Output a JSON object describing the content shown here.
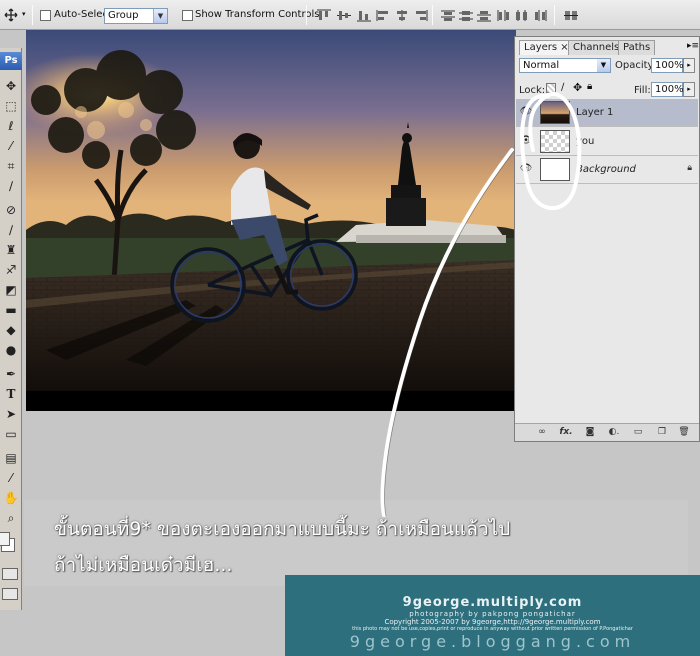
{
  "options_bar": {
    "move_tool_icon": "move-icon",
    "auto_select_label": "Auto-Select:",
    "auto_select_checked": false,
    "auto_select_value": "Group",
    "show_transform_label": "Show Transform Controls",
    "show_transform_checked": false
  },
  "toolbox": {
    "logo_text": "Ps",
    "tools": [
      "move-icon",
      "marquee-icon",
      "lasso-icon",
      "magic-wand-icon",
      "crop-icon",
      "slice-icon",
      "healing-brush-icon",
      "brush-icon",
      "clone-stamp-icon",
      "history-brush-icon",
      "eraser-icon",
      "gradient-icon",
      "blur-icon",
      "dodge-icon",
      "pen-icon",
      "type-icon",
      "path-selection-icon",
      "shape-icon",
      "notes-icon",
      "eyedropper-icon",
      "hand-icon",
      "zoom-icon"
    ],
    "type_tool_glyph": "T"
  },
  "layers_panel": {
    "tabs": [
      {
        "label": "Layers",
        "active": true
      },
      {
        "label": "Channels",
        "active": false
      },
      {
        "label": "Paths",
        "active": false
      }
    ],
    "blend_mode": "Normal",
    "opacity_label": "Opacity:",
    "opacity_value": "100%",
    "lock_label": "Lock:",
    "fill_label": "Fill:",
    "fill_value": "100%",
    "layers": [
      {
        "name": "Layer 1",
        "visible": true,
        "selected": true
      },
      {
        "name": "you",
        "visible": true,
        "selected": false
      },
      {
        "name": "Background",
        "visible": true,
        "selected": false,
        "locked": true
      }
    ]
  },
  "caption": {
    "line1": "ขั้นตอนที่9* ของตะเองออกมาแบบนี้มะ ถ้าเหมือนแล้วไป",
    "line2": "ถ้าไม่เหมือนเด๋วมีเฮ..."
  },
  "watermark": {
    "site": "9george.multiply.com",
    "credit": "photography by pakpong pongatichar",
    "copyright": "Copyright 2005-2007 by 9george,http://9george.multiply.com",
    "notice": "this photo may not be use,copies,print or reproduce in anyway without prior written permission of P.Pongatichar",
    "blog": "9george.bloggang.com"
  },
  "colors": {
    "selected_layer": "#b7bccd",
    "watermark_band": "#2e6f7e",
    "annotation_stroke": "#ffffff"
  }
}
